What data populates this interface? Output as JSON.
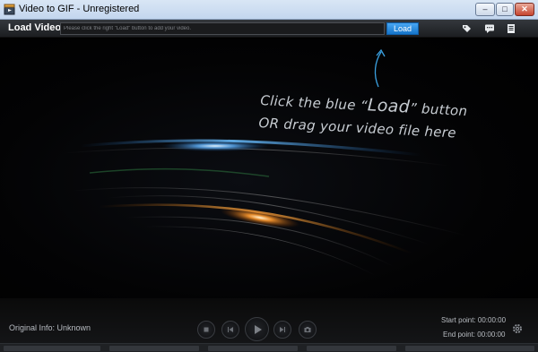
{
  "window": {
    "title": "Video to GIF - Unregistered",
    "minimize_glyph": "–",
    "maximize_glyph": "□",
    "close_glyph": "✕"
  },
  "toolbar": {
    "load_label": "Load Video:",
    "path_placeholder": "Please click the right \"Load\" button to add your video.",
    "load_button": "Load"
  },
  "viewport": {
    "hint_line1_a": "Click the blue “",
    "hint_line1_load": "Load",
    "hint_line1_b": "” button",
    "hint_line2": "OR drag your video file here"
  },
  "bottombar": {
    "original_info": "Original Info: Unknown",
    "start_point": "Start point: 00:00:00",
    "end_point": "End point: 00:00:00"
  },
  "colors": {
    "accent": "#1f8ae0",
    "background": "#000000",
    "text_muted": "#b8bcc2"
  },
  "icons": [
    "video-app-icon",
    "tag-icon",
    "chat-icon",
    "document-icon",
    "stop-icon",
    "previous-icon",
    "play-icon",
    "next-icon",
    "snapshot-icon",
    "gear-icon"
  ]
}
